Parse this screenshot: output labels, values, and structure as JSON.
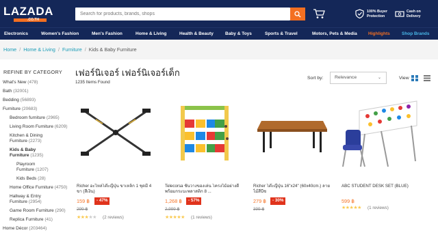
{
  "header": {
    "logo_text": "LAZADA",
    "logo_sub": ".CO.TH",
    "search_placeholder": "Search for products, brands, shops",
    "badges": [
      {
        "line1": "100% Buyer",
        "line2": "Protection"
      },
      {
        "line1": "Cash on",
        "line2": "Delivery"
      }
    ]
  },
  "nav": {
    "items": [
      "Electronics",
      "Women's Fashion",
      "Men's Fashion",
      "Home & Living",
      "Health & Beauty",
      "Baby & Toys",
      "Sports & Travel",
      "Motors, Pets & Media",
      "Highlights",
      "Shop Brands"
    ]
  },
  "breadcrumb": [
    "Home",
    "Home & Living",
    "Furniture",
    "Kids & Baby Furniture"
  ],
  "sidebar": {
    "heading": "REFINE BY CATEGORY",
    "items": [
      {
        "label": "What's New",
        "count": "(478)"
      },
      {
        "label": "Bath",
        "count": "(32001)"
      },
      {
        "label": "Bedding",
        "count": "(56893)"
      },
      {
        "label": "Furniture",
        "count": "(20683)"
      },
      {
        "label": "Bedroom furniture",
        "count": "(2965)"
      },
      {
        "label": "Living Room Furniture",
        "count": "(6209)"
      },
      {
        "label": "Kitchen & Dining",
        "label2": "Furniture",
        "count": "(2273)"
      },
      {
        "label": "Kids & Baby",
        "label2": "Furniture",
        "count": "(1235)"
      },
      {
        "label": "Playroom",
        "label2": "Furniture",
        "count": "(1207)"
      },
      {
        "label": "Kids Beds",
        "count": "(28)"
      },
      {
        "label": "Home Office Furniture",
        "count": "(4750)"
      },
      {
        "label": "Hallway & Entry",
        "label2": "Furniture",
        "count": "(2954)"
      },
      {
        "label": "Game Room Furniture",
        "count": "(290)"
      },
      {
        "label": "Replica Furniture",
        "count": "(41)"
      },
      {
        "label": "Home Décor",
        "count": "(203464)"
      }
    ]
  },
  "main": {
    "title": "เฟอร์นิเจอร์ เฟอร์นิเจอร์เด็ก",
    "items_found": "1235 Items Found",
    "sort_label": "Sort by:",
    "sort_value": "Relevance",
    "view_label": "View"
  },
  "products": [
    {
      "name": "Richer อะไหล่โต๊ะญี่ปุ่น ขาเหล็ก 1 ชุดมี 4 ขา (สีเงิน)",
      "price": "159 ฿",
      "discount": "- 47%",
      "old_price": "299 ฿",
      "rating": 3,
      "reviews": "(2 reviews)"
    },
    {
      "name": "Telecorsa ชั้นวางของเล่น โครงไม้อย่างดี พร้อมกระบะพลาสติก 8 ...",
      "price": "1,268 ฿",
      "discount": "- 57%",
      "old_price": "2,999 ฿",
      "rating": 5,
      "reviews": "(1 reviews)"
    },
    {
      "name": "Richer โต๊ะญี่ปุ่น 16\"x24\" (60x40cm.) ลายไม้สีบีช",
      "price": "279 ฿",
      "discount": "- 30%",
      "old_price": "399 ฿",
      "rating": 0,
      "reviews": ""
    },
    {
      "name": "ABC STUDENT DESK SET (BLUE)",
      "price": "599 ฿",
      "discount": "",
      "old_price": "",
      "rating": 5,
      "reviews": "(1 reviews)"
    }
  ],
  "colors": {
    "header": "#142758",
    "accent": "#f36f21",
    "link": "#1a9cb7",
    "discount": "#e0331c",
    "star": "#faca51"
  }
}
